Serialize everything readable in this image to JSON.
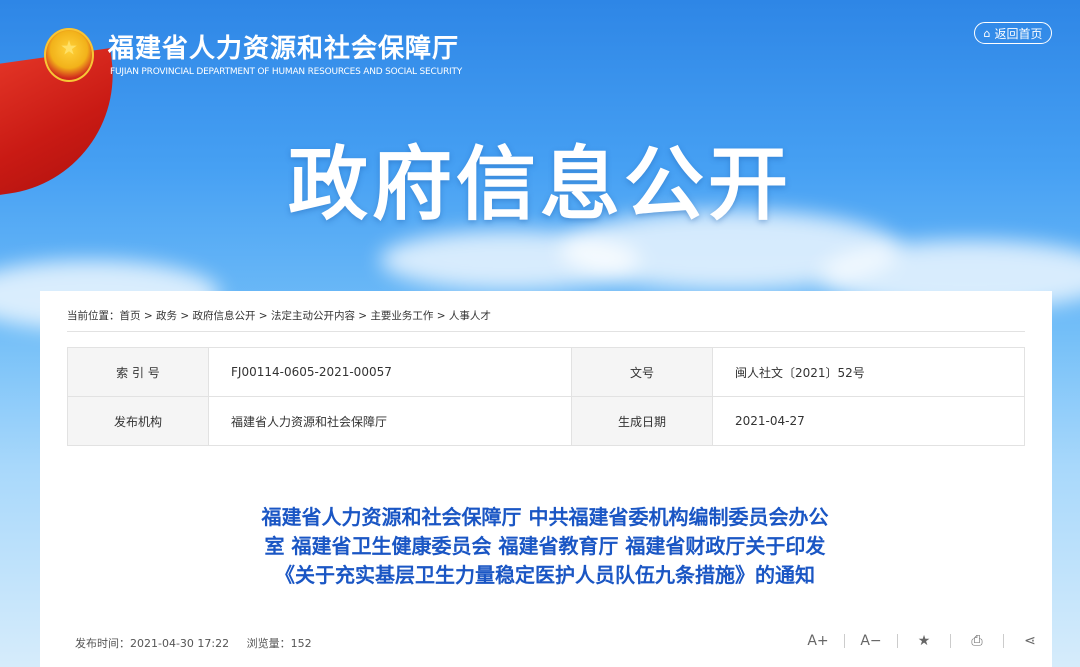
{
  "header": {
    "site_title": "福建省人力资源和社会保障厅",
    "site_subtitle": "FUJIAN PROVINCIAL DEPARTMENT OF HUMAN RESOURCES AND SOCIAL SECURITY",
    "back_home_label": "返回首页",
    "back_home_icon": "home-icon",
    "emblem": "national-emblem-icon"
  },
  "banner": {
    "title": "政府信息公开"
  },
  "breadcrumb": {
    "prefix": "当前位置：",
    "items": [
      "首页",
      "政务",
      "政府信息公开",
      "法定主动公开内容",
      "主要业务工作",
      "人事人才"
    ],
    "separator": " > "
  },
  "meta": {
    "index_label": "索 引 号",
    "index_value": "FJ00114-0605-2021-00057",
    "docno_label": "文号",
    "docno_value": "闽人社文〔2021〕52号",
    "publisher_label": "发布机构",
    "publisher_value": "福建省人力资源和社会保障厅",
    "date_label": "生成日期",
    "date_value": "2021-04-27"
  },
  "document": {
    "title_line1": "福建省人力资源和社会保障厅 中共福建省委机构编制委员会办公",
    "title_line2": "室 福建省卫生健康委员会 福建省教育厅 福建省财政厅关于印发",
    "title_line3": "《关于充实基层卫生力量稳定医护人员队伍九条措施》的通知"
  },
  "pubinfo": {
    "publish_time": "发布时间：2021-04-30 17:22",
    "views": "浏览量：152"
  },
  "tools": {
    "font_up": "A+",
    "font_down": "A−"
  },
  "colors": {
    "title_blue": "#1a56c4",
    "flag_red": "#c91a14",
    "sky_blue": "#2e86e6"
  }
}
